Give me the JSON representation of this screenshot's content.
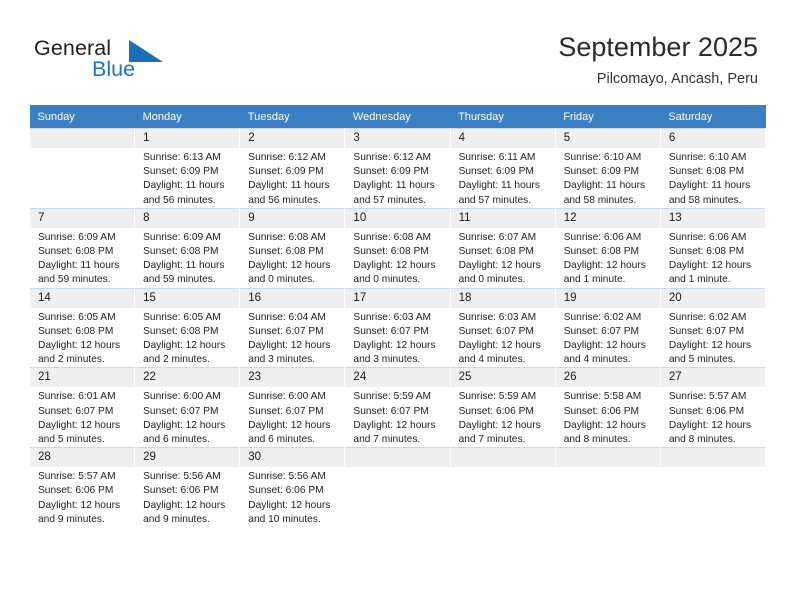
{
  "brand": {
    "name_top": "General",
    "name_bottom": "Blue",
    "flag_icon": "blue-triangle-flag-icon",
    "accent_color": "#1b75bb"
  },
  "header": {
    "title": "September 2025",
    "subtitle": "Pilcomayo, Ancash, Peru"
  },
  "theme": {
    "header_row_color": "#3b7fc4",
    "daynum_background": "#efefef",
    "grid_line_color": "#c9d9ea"
  },
  "weekday_headers": [
    "Sunday",
    "Monday",
    "Tuesday",
    "Wednesday",
    "Thursday",
    "Friday",
    "Saturday"
  ],
  "labels": {
    "sunrise_prefix": "Sunrise:",
    "sunset_prefix": "Sunset:",
    "daylight_prefix": "Daylight:"
  },
  "weeks": [
    [
      {
        "day": "",
        "sunrise": "",
        "sunset": "",
        "daylight_line1": "",
        "daylight_line2": "",
        "empty": true
      },
      {
        "day": "1",
        "sunrise": "Sunrise: 6:13 AM",
        "sunset": "Sunset: 6:09 PM",
        "daylight_line1": "Daylight: 11 hours",
        "daylight_line2": "and 56 minutes."
      },
      {
        "day": "2",
        "sunrise": "Sunrise: 6:12 AM",
        "sunset": "Sunset: 6:09 PM",
        "daylight_line1": "Daylight: 11 hours",
        "daylight_line2": "and 56 minutes."
      },
      {
        "day": "3",
        "sunrise": "Sunrise: 6:12 AM",
        "sunset": "Sunset: 6:09 PM",
        "daylight_line1": "Daylight: 11 hours",
        "daylight_line2": "and 57 minutes."
      },
      {
        "day": "4",
        "sunrise": "Sunrise: 6:11 AM",
        "sunset": "Sunset: 6:09 PM",
        "daylight_line1": "Daylight: 11 hours",
        "daylight_line2": "and 57 minutes."
      },
      {
        "day": "5",
        "sunrise": "Sunrise: 6:10 AM",
        "sunset": "Sunset: 6:09 PM",
        "daylight_line1": "Daylight: 11 hours",
        "daylight_line2": "and 58 minutes."
      },
      {
        "day": "6",
        "sunrise": "Sunrise: 6:10 AM",
        "sunset": "Sunset: 6:08 PM",
        "daylight_line1": "Daylight: 11 hours",
        "daylight_line2": "and 58 minutes."
      }
    ],
    [
      {
        "day": "7",
        "sunrise": "Sunrise: 6:09 AM",
        "sunset": "Sunset: 6:08 PM",
        "daylight_line1": "Daylight: 11 hours",
        "daylight_line2": "and 59 minutes."
      },
      {
        "day": "8",
        "sunrise": "Sunrise: 6:09 AM",
        "sunset": "Sunset: 6:08 PM",
        "daylight_line1": "Daylight: 11 hours",
        "daylight_line2": "and 59 minutes."
      },
      {
        "day": "9",
        "sunrise": "Sunrise: 6:08 AM",
        "sunset": "Sunset: 6:08 PM",
        "daylight_line1": "Daylight: 12 hours",
        "daylight_line2": "and 0 minutes."
      },
      {
        "day": "10",
        "sunrise": "Sunrise: 6:08 AM",
        "sunset": "Sunset: 6:08 PM",
        "daylight_line1": "Daylight: 12 hours",
        "daylight_line2": "and 0 minutes."
      },
      {
        "day": "11",
        "sunrise": "Sunrise: 6:07 AM",
        "sunset": "Sunset: 6:08 PM",
        "daylight_line1": "Daylight: 12 hours",
        "daylight_line2": "and 0 minutes."
      },
      {
        "day": "12",
        "sunrise": "Sunrise: 6:06 AM",
        "sunset": "Sunset: 6:08 PM",
        "daylight_line1": "Daylight: 12 hours",
        "daylight_line2": "and 1 minute."
      },
      {
        "day": "13",
        "sunrise": "Sunrise: 6:06 AM",
        "sunset": "Sunset: 6:08 PM",
        "daylight_line1": "Daylight: 12 hours",
        "daylight_line2": "and 1 minute."
      }
    ],
    [
      {
        "day": "14",
        "sunrise": "Sunrise: 6:05 AM",
        "sunset": "Sunset: 6:08 PM",
        "daylight_line1": "Daylight: 12 hours",
        "daylight_line2": "and 2 minutes."
      },
      {
        "day": "15",
        "sunrise": "Sunrise: 6:05 AM",
        "sunset": "Sunset: 6:08 PM",
        "daylight_line1": "Daylight: 12 hours",
        "daylight_line2": "and 2 minutes."
      },
      {
        "day": "16",
        "sunrise": "Sunrise: 6:04 AM",
        "sunset": "Sunset: 6:07 PM",
        "daylight_line1": "Daylight: 12 hours",
        "daylight_line2": "and 3 minutes."
      },
      {
        "day": "17",
        "sunrise": "Sunrise: 6:03 AM",
        "sunset": "Sunset: 6:07 PM",
        "daylight_line1": "Daylight: 12 hours",
        "daylight_line2": "and 3 minutes."
      },
      {
        "day": "18",
        "sunrise": "Sunrise: 6:03 AM",
        "sunset": "Sunset: 6:07 PM",
        "daylight_line1": "Daylight: 12 hours",
        "daylight_line2": "and 4 minutes."
      },
      {
        "day": "19",
        "sunrise": "Sunrise: 6:02 AM",
        "sunset": "Sunset: 6:07 PM",
        "daylight_line1": "Daylight: 12 hours",
        "daylight_line2": "and 4 minutes."
      },
      {
        "day": "20",
        "sunrise": "Sunrise: 6:02 AM",
        "sunset": "Sunset: 6:07 PM",
        "daylight_line1": "Daylight: 12 hours",
        "daylight_line2": "and 5 minutes."
      }
    ],
    [
      {
        "day": "21",
        "sunrise": "Sunrise: 6:01 AM",
        "sunset": "Sunset: 6:07 PM",
        "daylight_line1": "Daylight: 12 hours",
        "daylight_line2": "and 5 minutes."
      },
      {
        "day": "22",
        "sunrise": "Sunrise: 6:00 AM",
        "sunset": "Sunset: 6:07 PM",
        "daylight_line1": "Daylight: 12 hours",
        "daylight_line2": "and 6 minutes."
      },
      {
        "day": "23",
        "sunrise": "Sunrise: 6:00 AM",
        "sunset": "Sunset: 6:07 PM",
        "daylight_line1": "Daylight: 12 hours",
        "daylight_line2": "and 6 minutes."
      },
      {
        "day": "24",
        "sunrise": "Sunrise: 5:59 AM",
        "sunset": "Sunset: 6:07 PM",
        "daylight_line1": "Daylight: 12 hours",
        "daylight_line2": "and 7 minutes."
      },
      {
        "day": "25",
        "sunrise": "Sunrise: 5:59 AM",
        "sunset": "Sunset: 6:06 PM",
        "daylight_line1": "Daylight: 12 hours",
        "daylight_line2": "and 7 minutes."
      },
      {
        "day": "26",
        "sunrise": "Sunrise: 5:58 AM",
        "sunset": "Sunset: 6:06 PM",
        "daylight_line1": "Daylight: 12 hours",
        "daylight_line2": "and 8 minutes."
      },
      {
        "day": "27",
        "sunrise": "Sunrise: 5:57 AM",
        "sunset": "Sunset: 6:06 PM",
        "daylight_line1": "Daylight: 12 hours",
        "daylight_line2": "and 8 minutes."
      }
    ],
    [
      {
        "day": "28",
        "sunrise": "Sunrise: 5:57 AM",
        "sunset": "Sunset: 6:06 PM",
        "daylight_line1": "Daylight: 12 hours",
        "daylight_line2": "and 9 minutes."
      },
      {
        "day": "29",
        "sunrise": "Sunrise: 5:56 AM",
        "sunset": "Sunset: 6:06 PM",
        "daylight_line1": "Daylight: 12 hours",
        "daylight_line2": "and 9 minutes."
      },
      {
        "day": "30",
        "sunrise": "Sunrise: 5:56 AM",
        "sunset": "Sunset: 6:06 PM",
        "daylight_line1": "Daylight: 12 hours",
        "daylight_line2": "and 10 minutes."
      },
      {
        "day": "",
        "sunrise": "",
        "sunset": "",
        "daylight_line1": "",
        "daylight_line2": "",
        "blank": true
      },
      {
        "day": "",
        "sunrise": "",
        "sunset": "",
        "daylight_line1": "",
        "daylight_line2": "",
        "blank": true
      },
      {
        "day": "",
        "sunrise": "",
        "sunset": "",
        "daylight_line1": "",
        "daylight_line2": "",
        "blank": true
      },
      {
        "day": "",
        "sunrise": "",
        "sunset": "",
        "daylight_line1": "",
        "daylight_line2": "",
        "blank": true
      }
    ]
  ]
}
